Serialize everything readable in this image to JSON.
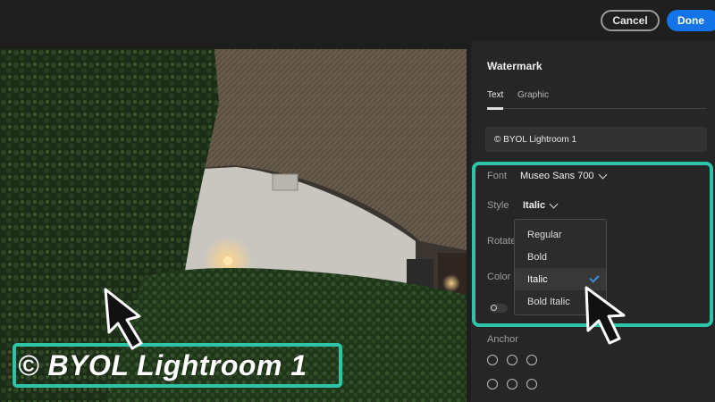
{
  "topbar": {
    "cancel_label": "Cancel",
    "done_label": "Done"
  },
  "photo": {
    "watermark_text": "© BYOL Lightroom 1",
    "arrow_icon": "arrow-pointer-icon"
  },
  "panel": {
    "title": "Watermark",
    "tabs": [
      {
        "label": "Text",
        "active": true
      },
      {
        "label": "Graphic",
        "active": false
      }
    ],
    "text_field_value": "© BYOL Lightroom 1",
    "font": {
      "label": "Font",
      "value": "Museo Sans 700"
    },
    "style": {
      "label": "Style",
      "value": "Italic"
    },
    "rotate_label": "Rotate",
    "color_label": "Color",
    "anchor_label": "Anchor"
  },
  "style_dropdown": {
    "options": [
      "Regular",
      "Bold",
      "Italic",
      "Bold Italic"
    ],
    "selected": "Italic"
  },
  "colors": {
    "accent": "#1473e6",
    "highlight": "#2ec4a6",
    "check": "#3a8dde"
  }
}
